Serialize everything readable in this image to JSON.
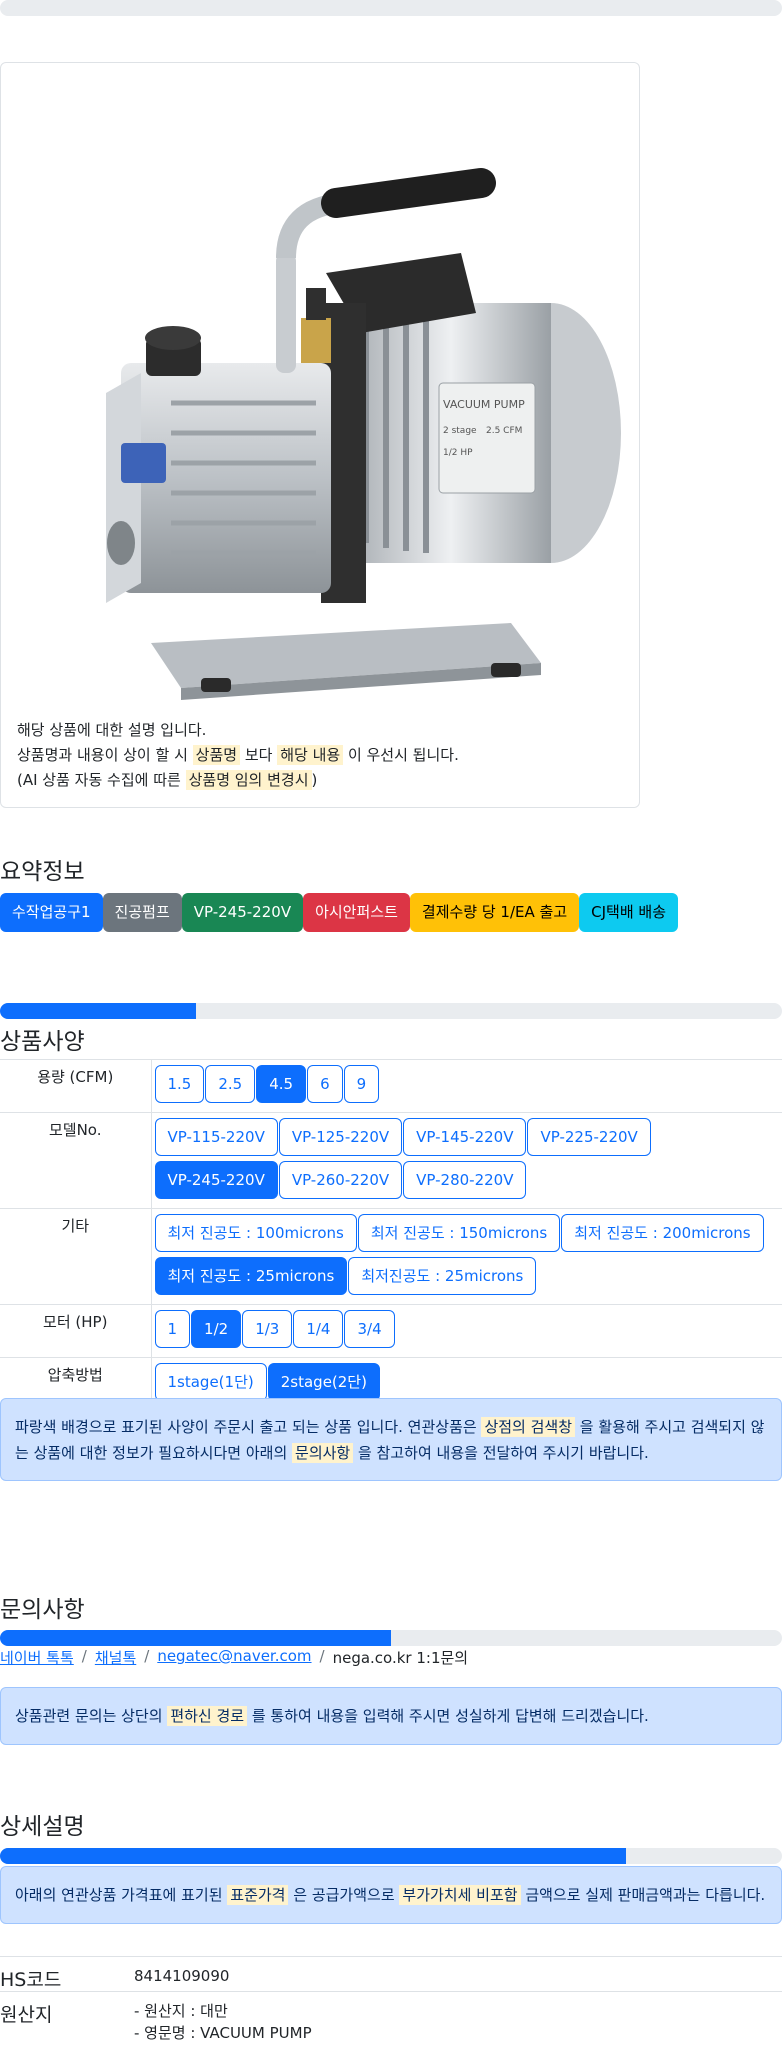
{
  "card": {
    "line1": "해당 상품에 대한 설명 입니다.",
    "line2_a": "상품명과 내용이 상이 할 시 ",
    "line2_b": "상품명",
    "line2_c": " 보다 ",
    "line2_d": "해당 내용",
    "line2_e": " 이 우선시 됩니다.",
    "line3_a": "(AI 상품 자동 수집에 따른 ",
    "line3_b": "상품명 임의 변경시",
    "line3_c": ")"
  },
  "pump_label": {
    "title": "VACUUM PUMP",
    "stage": "2 stage",
    "cfm": "2.5 CFM",
    "hp": "1/2 HP"
  },
  "summary": {
    "title": "요약정보",
    "badges": [
      {
        "label": "수작업공구1",
        "color": "#0d6efd",
        "text": "#ffffff"
      },
      {
        "label": "진공펌프",
        "color": "#6c757d",
        "text": "#ffffff"
      },
      {
        "label": "VP-245-220V",
        "color": "#198754",
        "text": "#ffffff"
      },
      {
        "label": "아시안퍼스트",
        "color": "#dc3545",
        "text": "#ffffff"
      },
      {
        "label": "결제수량 당 1/EA 출고",
        "color": "#ffc107",
        "text": "#000000"
      },
      {
        "label": "CJ택배 배송",
        "color": "#0dcaf0",
        "text": "#000000"
      }
    ]
  },
  "spec": {
    "title": "상품사양",
    "progress": 0.25,
    "rows": [
      {
        "label": "용량 (CFM)",
        "options": [
          "1.5",
          "2.5",
          "4.5",
          "6",
          "9"
        ],
        "selected": 2
      },
      {
        "label": "모델No.",
        "options": [
          "VP-115-220V",
          "VP-125-220V",
          "VP-145-220V",
          "VP-225-220V",
          "VP-245-220V",
          "VP-260-220V",
          "VP-280-220V"
        ],
        "selected": 4
      },
      {
        "label": "기타",
        "options": [
          "최저 진공도 : 100microns",
          "최저 진공도 : 150microns",
          "최저 진공도 : 200microns",
          "최저 진공도 : 25microns",
          "최저진공도 : 25microns"
        ],
        "selected": 3
      },
      {
        "label": "모터 (HP)",
        "options": [
          "1",
          "1/2",
          "1/3",
          "1/4",
          "3/4"
        ],
        "selected": 1
      },
      {
        "label": "압축방법",
        "options": [
          "1stage(1단)",
          "2stage(2단)"
        ],
        "selected": 1
      }
    ],
    "notice_a": "파랑색 배경으로 표기된 사양이 주문시 출고 되는 상품 입니다. 연관상품은 ",
    "notice_b": "상점의 검색창",
    "notice_c": " 을 활용해 주시고 검색되지 않는 상품에 대한 정보가 필요하시다면 아래의 ",
    "notice_d": "문의사항",
    "notice_e": " 을 참고하여 내용을 전달하여 주시기 바랍니다."
  },
  "inquiry": {
    "title": "문의사항",
    "progress": 0.5,
    "links": [
      "네이버 톡톡",
      "채널톡",
      "negatec@naver.com"
    ],
    "plain": "nega.co.kr 1:1문의",
    "notice_a": "상품관련 문의는 상단의 ",
    "notice_b": "편하신 경로",
    "notice_c": " 를 통하여 내용을 입력해 주시면 성실하게 답변해 드리겠습니다."
  },
  "detail": {
    "title": "상세설명",
    "progress": 0.8,
    "notice_a": "아래의 연관상품 가격표에 표기된 ",
    "notice_b": "표준가격",
    "notice_c": " 은 공급가액으로 ",
    "notice_d": "부가가치세 비포함",
    "notice_e": " 금액으로 실제 판매금액과는 다릅니다.",
    "hs_label": "HS코드",
    "hs_value": "8414109090",
    "origin_label": "원산지",
    "origin_line1": "- 원산지 : 대만",
    "origin_line2": "- 영문명 : VACUUM PUMP"
  }
}
